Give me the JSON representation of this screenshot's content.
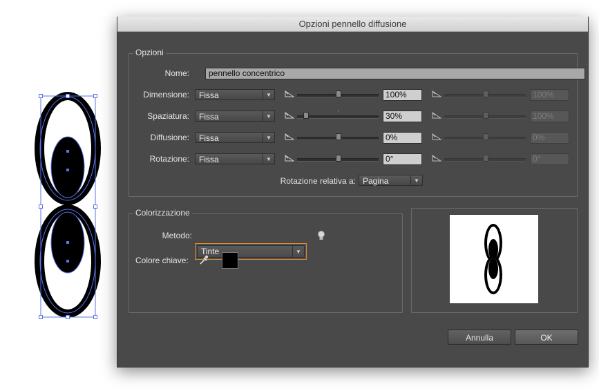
{
  "dialog": {
    "title": "Opzioni pennello diffusione"
  },
  "options": {
    "legend": "Opzioni",
    "name_label": "Nome:",
    "name_value": "pennello concentrico",
    "rows": [
      {
        "label": "Dimensione:",
        "mode": "Fissa",
        "value": "100%",
        "value2": "100%",
        "level": 0.5
      },
      {
        "label": "Spaziatura:",
        "mode": "Fissa",
        "value": "30%",
        "value2": "100%",
        "level": 0.1
      },
      {
        "label": "Diffusione:",
        "mode": "Fissa",
        "value": "0%",
        "value2": "0%",
        "level": 0.5
      },
      {
        "label": "Rotazione:",
        "mode": "Fissa",
        "value": "0°",
        "value2": "0°",
        "level": 0.5
      }
    ],
    "rotation_relative_label": "Rotazione relativa a:",
    "rotation_relative_value": "Pagina"
  },
  "colorization": {
    "legend": "Colorizzazione",
    "method_label": "Metodo:",
    "method_value": "Tinte",
    "key_color_label": "Colore chiave:",
    "key_color": "#000000"
  },
  "buttons": {
    "cancel": "Annulla",
    "ok": "OK"
  },
  "colors": {
    "accent": "#e08a2c",
    "dialog_bg": "#494949",
    "selection": "#5b74e8"
  },
  "icons": {
    "tip": "lightbulb-icon",
    "eyedropper": "eyedropper-icon",
    "slider": "pressure-slider-icon"
  }
}
